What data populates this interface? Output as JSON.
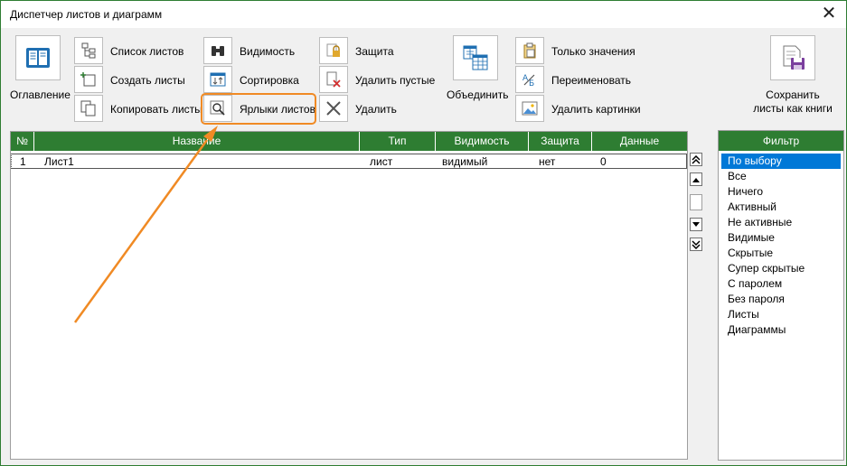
{
  "window": {
    "title": "Диспетчер листов и диаграмм",
    "close_label": "✕"
  },
  "toolbar": {
    "toc_label": "Оглавление",
    "sheet_list_label": "Список листов",
    "create_sheets_label": "Создать листы",
    "copy_sheets_label": "Копировать листы",
    "visibility_label": "Видимость",
    "sort_label": "Сортировка",
    "sheet_tabs_label": "Ярлыки листов",
    "protection_label": "Защита",
    "delete_empty_label": "Удалить пустые",
    "delete_label": "Удалить",
    "merge_label": "Объединить",
    "values_only_label": "Только значения",
    "rename_label": "Переименовать",
    "delete_pictures_label": "Удалить картинки",
    "save_as_books_line1": "Сохранить",
    "save_as_books_line2": "листы как книги"
  },
  "grid": {
    "columns": [
      "№",
      "Название",
      "Тип",
      "Видимость",
      "Защита",
      "Данные"
    ],
    "rows": [
      {
        "num": "1",
        "name": "Лист1",
        "type": "лист",
        "visibility": "видимый",
        "protection": "нет",
        "data": "0"
      }
    ]
  },
  "filter": {
    "header": "Фильтр",
    "items": [
      "По выбору",
      "Все",
      "Ничего",
      "Активный",
      "Не активные",
      "Видимые",
      "Скрытые",
      "Супер скрытые",
      "С паролем",
      "Без пароля",
      "Листы",
      "Диаграммы"
    ],
    "selected": "По выбору"
  },
  "colors": {
    "accent": "#2e7d32",
    "highlight": "#f08a24",
    "selection": "#0078d7"
  }
}
